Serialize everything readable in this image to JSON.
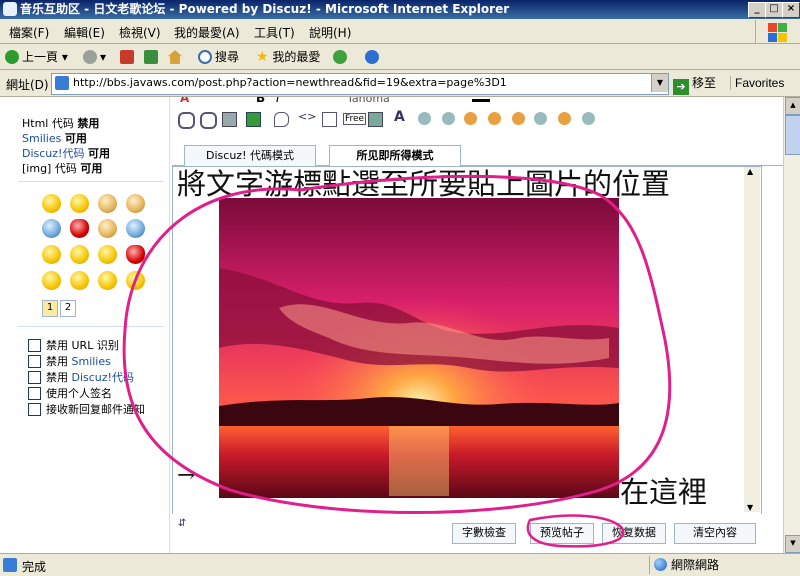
{
  "window": {
    "title": "音乐互助区 - 日文老歌论坛 - Powered by Discuz! - Microsoft Internet Explorer",
    "controls": {
      "minimize": "_",
      "maximize": "□",
      "close": "×"
    }
  },
  "menu": [
    "檔案(F)",
    "編輯(E)",
    "檢視(V)",
    "我的最愛(A)",
    "工具(T)",
    "說明(H)"
  ],
  "toolbar": {
    "back": "上一頁",
    "search": "搜尋",
    "favorites": "我的最愛"
  },
  "address": {
    "label": "網址(D)",
    "url": "http://bbs.javaws.com/post.php?action=newthread&fid=19&extra=page%3D1",
    "go": "移至",
    "links": "Favorites"
  },
  "sidebar": {
    "html_label": "Html 代码",
    "html_state": "禁用",
    "smilies_label": "Smilies",
    "smilies_state": "可用",
    "discuz_label": "Discuz!代码",
    "discuz_state": "可用",
    "img_label": "[img] 代码",
    "img_state": "可用",
    "pages": [
      "1",
      "2"
    ],
    "options": [
      "禁用 URL 识别",
      "禁用 Smilies",
      "禁用 Discuz!代码",
      "使用个人签名",
      "接收新回复邮件通知"
    ]
  },
  "editor": {
    "font_name": "Tahoma",
    "tab_code": "Discuz! 代碼模式",
    "tab_wysiwyg": "所见即所得模式",
    "line1": "將文字游標點選至所要貼上圖片的位置",
    "line2": "在這裡",
    "arrow_text": "→"
  },
  "buttons": {
    "check_length": "字數檢查",
    "preview": "预览帖子",
    "restore": "恢复数据",
    "clear": "清空內容"
  },
  "status": {
    "text": "完成",
    "zone": "網際網路"
  }
}
